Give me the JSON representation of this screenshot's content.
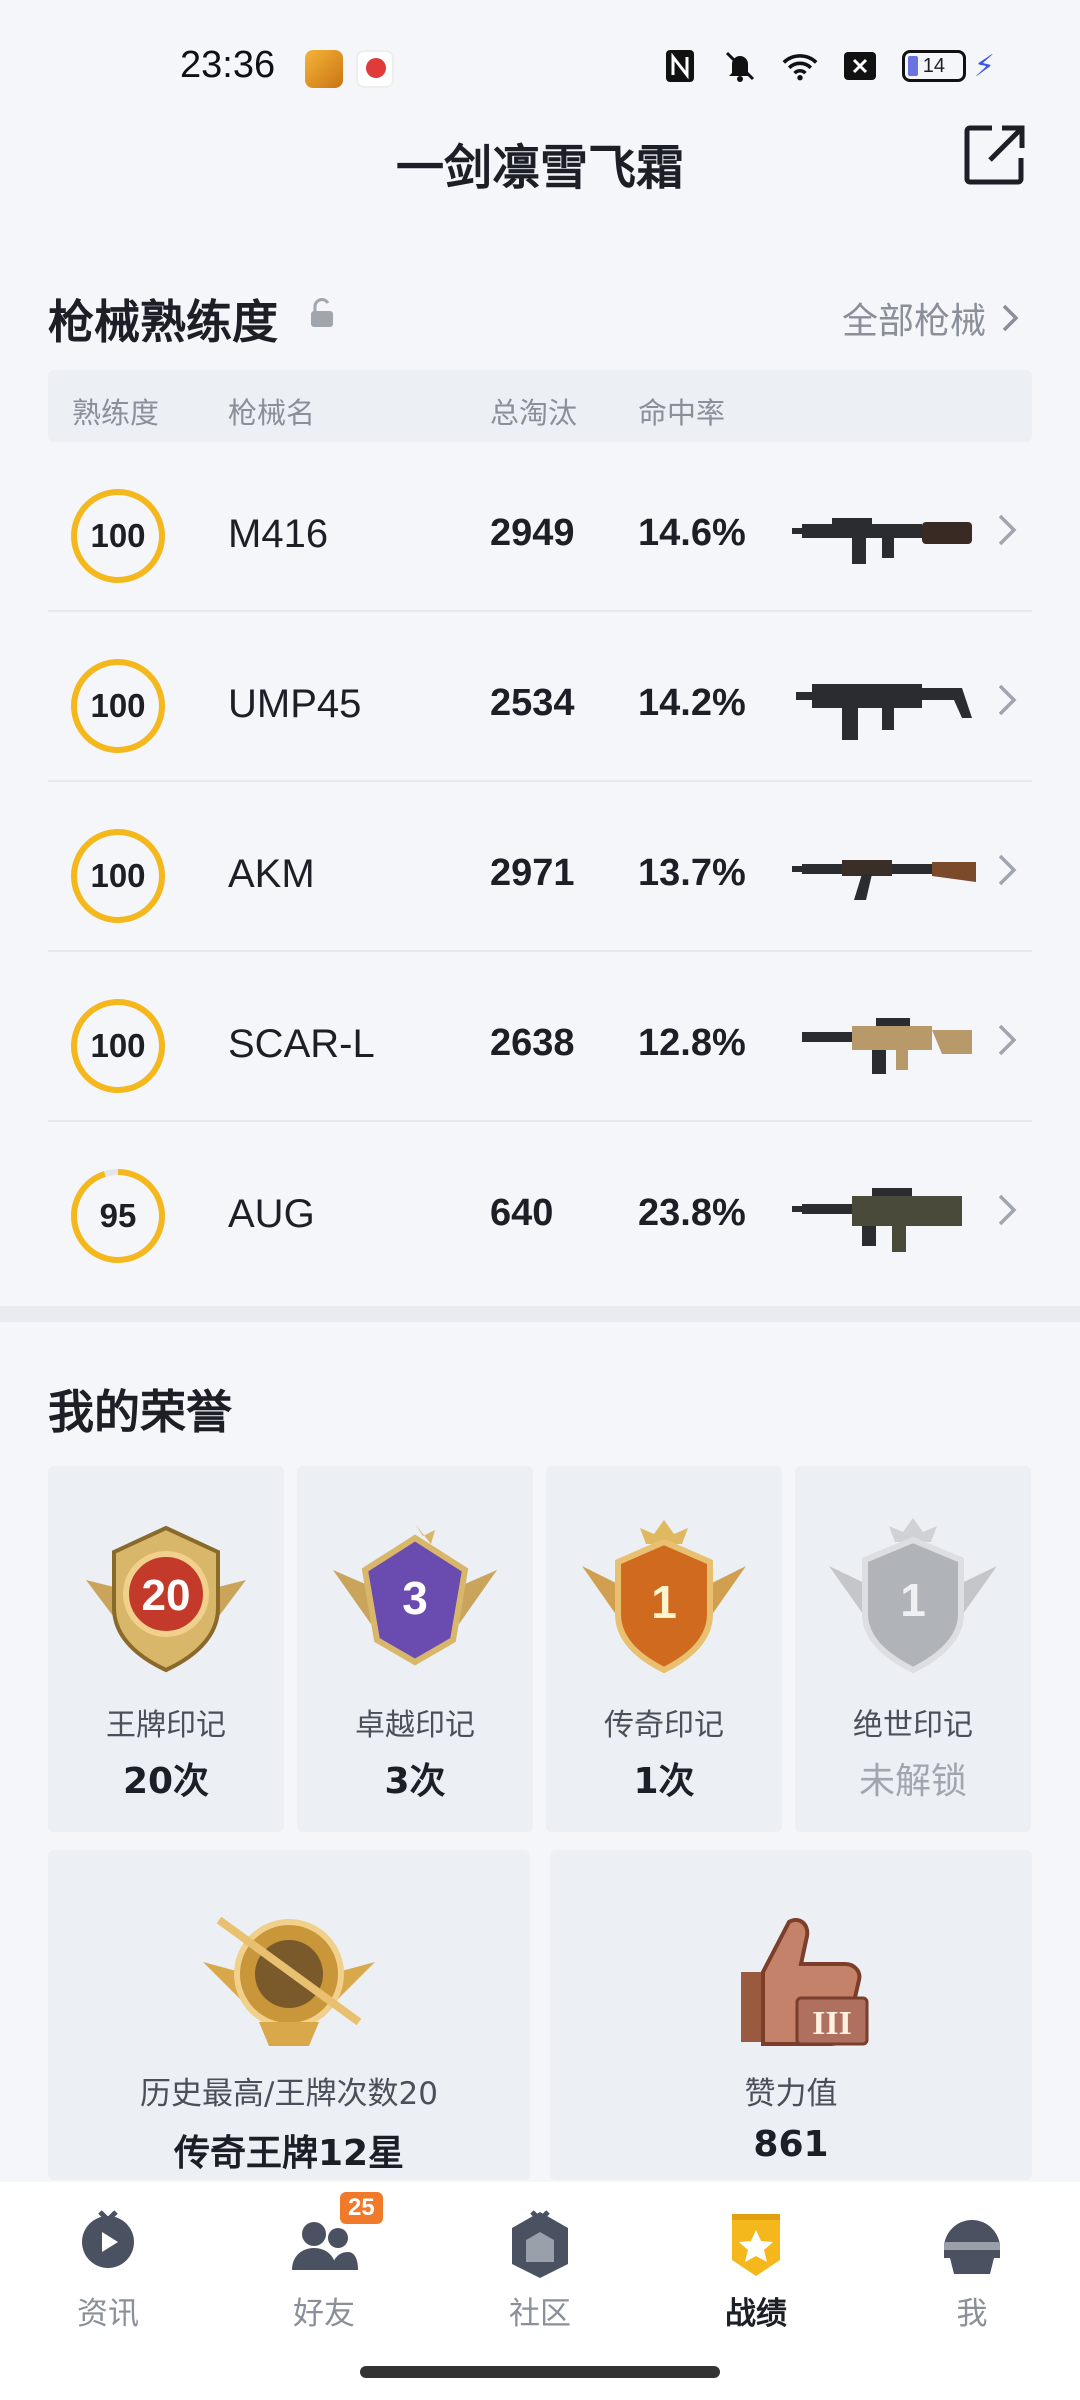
{
  "status_bar": {
    "time": "23:36",
    "battery": "14",
    "icons": [
      "nfc-icon",
      "bell-muted-icon",
      "wifi-icon",
      "sim-x-icon",
      "battery-icon",
      "charging-icon"
    ]
  },
  "header": {
    "title": "一剑凛雪飞霜",
    "share_icon": "share-icon"
  },
  "weapons": {
    "title": "枪械熟练度",
    "lock_icon": "lock-icon",
    "all_link": "全部枪械",
    "columns": [
      "熟练度",
      "枪械名",
      "总淘汰",
      "命中率"
    ],
    "rows": [
      {
        "proficiency": "100",
        "progress": 1.0,
        "name": "M416",
        "kills": "2949",
        "hit_rate": "14.6%"
      },
      {
        "proficiency": "100",
        "progress": 1.0,
        "name": "UMP45",
        "kills": "2534",
        "hit_rate": "14.2%"
      },
      {
        "proficiency": "100",
        "progress": 1.0,
        "name": "AKM",
        "kills": "2971",
        "hit_rate": "13.7%"
      },
      {
        "proficiency": "100",
        "progress": 1.0,
        "name": "SCAR-L",
        "kills": "2638",
        "hit_rate": "12.8%"
      },
      {
        "proficiency": "95",
        "progress": 0.95,
        "name": "AUG",
        "kills": "640",
        "hit_rate": "23.8%"
      }
    ]
  },
  "honors": {
    "title": "我的荣誉",
    "cards": [
      {
        "label": "王牌印记",
        "value": "20次",
        "badge_number": "20",
        "color": "#c43a2a"
      },
      {
        "label": "卓越印记",
        "value": "3次",
        "badge_number": "3",
        "color": "#6a4bb0"
      },
      {
        "label": "传奇印记",
        "value": "1次",
        "badge_number": "1",
        "color": "#d06a1e"
      },
      {
        "label": "绝世印记",
        "value": "未解锁",
        "badge_number": "1",
        "color": "#b0b3b8"
      }
    ],
    "wide_cards": [
      {
        "label": "历史最高/王牌次数20",
        "value": "传奇王牌12星"
      },
      {
        "label": "赞力值",
        "value": "861"
      }
    ]
  },
  "bottom_nav": {
    "items": [
      {
        "label": "资讯",
        "icon": "news-icon",
        "active": false
      },
      {
        "label": "好友",
        "icon": "friends-icon",
        "active": false,
        "badge": "25"
      },
      {
        "label": "社区",
        "icon": "community-icon",
        "active": false
      },
      {
        "label": "战绩",
        "icon": "record-icon",
        "active": true
      },
      {
        "label": "我",
        "icon": "profile-icon",
        "active": false
      }
    ]
  },
  "colors": {
    "accent": "#f5b81c",
    "ring_track": "#e3e6eb",
    "text_primary": "#1c1f26",
    "text_secondary": "#8a8f99"
  }
}
